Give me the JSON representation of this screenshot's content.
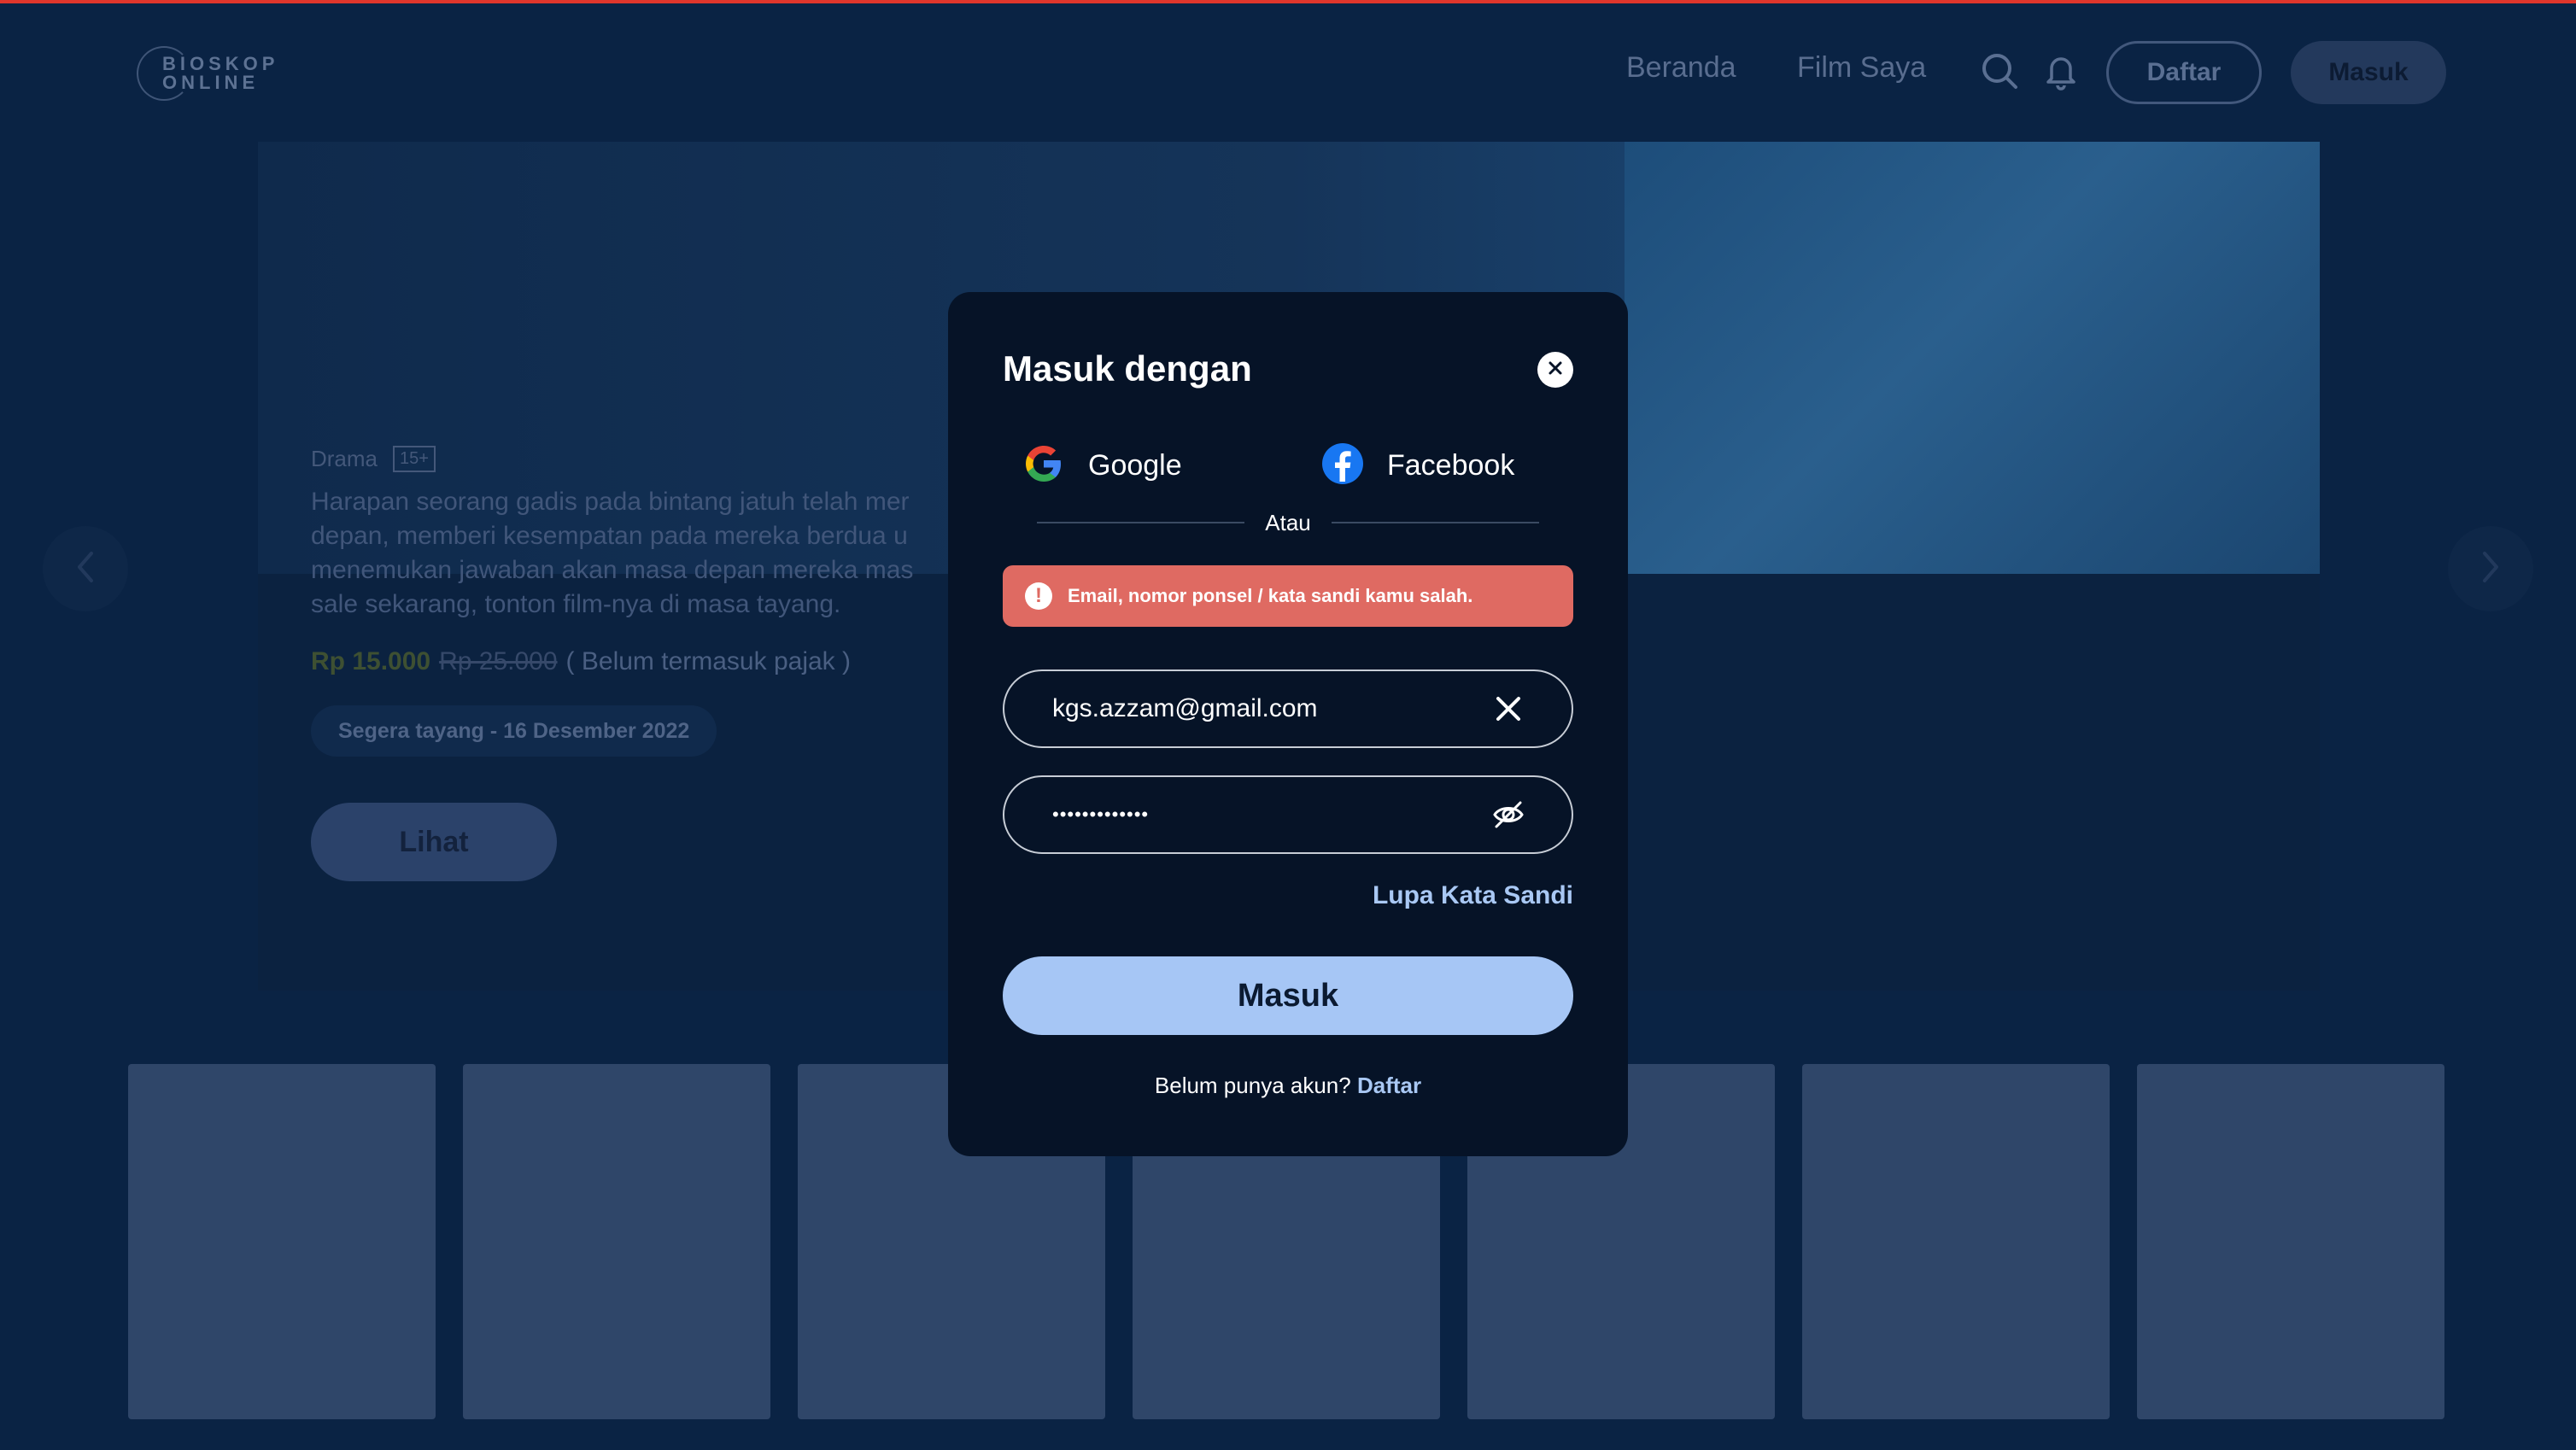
{
  "colors": {
    "accent_top": "#e0362c",
    "page_background": "#0a2344",
    "modal_background": "#061327",
    "error_background": "#df6a62",
    "primary_button": "#a6c6f5",
    "link": "#a9c8f4",
    "facebook": "#1877f2"
  },
  "nav": {
    "logo_line1": "BIOSKOP",
    "logo_line2": "ONLINE",
    "links": [
      {
        "label": "Beranda"
      },
      {
        "label": "Film Saya"
      }
    ],
    "icons": [
      "search-icon",
      "bell-icon"
    ],
    "register_label": "Daftar",
    "login_label": "Masuk"
  },
  "hero": {
    "genre": "Drama",
    "age_rating": "15+",
    "description": "Harapan seorang gadis pada bintang jatuh telah mer depan, memberi kesempatan pada mereka berdua u menemukan jawaban akan masa depan mereka mas sale sekarang, tonton film-nya di masa tayang.",
    "price": "Rp 15.000",
    "price_old": "Rp 25.000",
    "price_note": "( Belum termasuk pajak )",
    "badge": "Segera tayang - 16 Desember 2022",
    "button_label": "Lihat"
  },
  "carousel": {
    "prev_icon": "chevron-left-icon",
    "next_icon": "chevron-right-icon"
  },
  "modal": {
    "title": "Masuk dengan",
    "close_icon": "close-icon",
    "google_label": "Google",
    "facebook_label": "Facebook",
    "divider_text": "Atau",
    "error_message": "Email, nomor ponsel / kata sandi kamu salah.",
    "email_value": "kgs.azzam@gmail.com",
    "password_value": "•••••••••••••",
    "forgot_password": "Lupa Kata Sandi",
    "submit_label": "Masuk",
    "signup_prompt": "Belum punya akun?",
    "signup_link": "Daftar"
  }
}
